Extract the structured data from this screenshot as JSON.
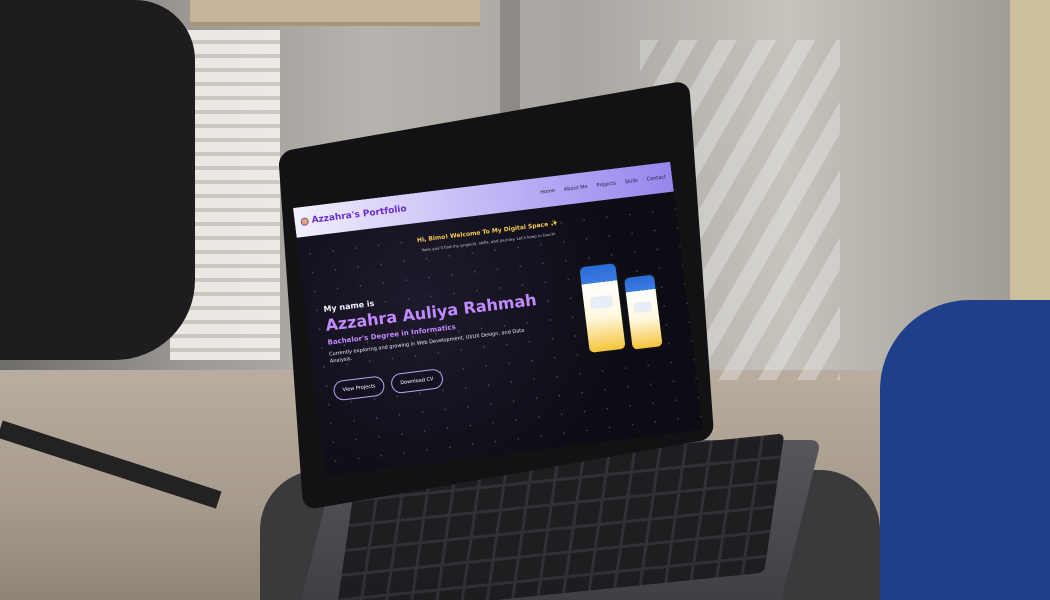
{
  "site": {
    "brand": "Azzahra's Portfolio",
    "nav": [
      "Home",
      "About Me",
      "Projects",
      "Skills",
      "Contact"
    ]
  },
  "hero": {
    "welcome": "Hi, Bimo! Welcome To My Digital Space ✨",
    "welcome_sub": "Here you'll find my projects, skills, and journey. Let's keep in touch!",
    "intro": "My name is",
    "name": "Azzahra Auliya Rahmah",
    "degree": "Bachelor's Degree in Informatics",
    "tagline": "Currently exploring and growing in Web Development, UI/UX Design, and Data Analysis.",
    "buttons": {
      "view_projects": "View Projects",
      "download_cv": "Download CV"
    }
  },
  "colors": {
    "accent": "#c08bff",
    "welcome": "#f2c94c",
    "nav_gradient_end": "#9886ee",
    "screen_bg": "#0d0b14"
  }
}
